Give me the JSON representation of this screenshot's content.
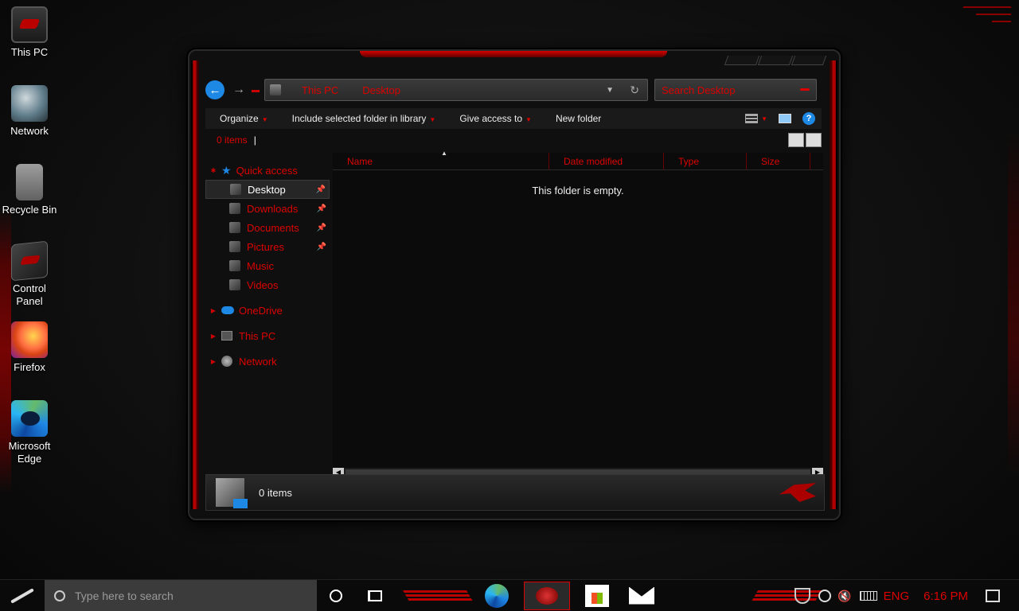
{
  "desktop": {
    "icons": [
      {
        "label": "This PC",
        "icon": "this-pc-icon"
      },
      {
        "label": "Network",
        "icon": "network-globe-icon"
      },
      {
        "label": "Recycle Bin",
        "icon": "recycle-bin-icon"
      },
      {
        "label": "Control Panel",
        "icon": "control-panel-icon"
      },
      {
        "label": "Firefox",
        "icon": "firefox-icon"
      },
      {
        "label": "Microsoft Edge",
        "icon": "edge-icon"
      }
    ]
  },
  "explorer": {
    "address": {
      "crumbs": [
        "This PC",
        "Desktop"
      ]
    },
    "search_placeholder": "Search Desktop",
    "toolbar": {
      "organize": "Organize",
      "include": "Include selected folder in library",
      "give_access": "Give access to",
      "new_folder": "New folder"
    },
    "status_top": "0 items",
    "nav": {
      "quick_access": "Quick access",
      "quick_items": [
        {
          "label": "Desktop",
          "pinned": true,
          "selected": true
        },
        {
          "label": "Downloads",
          "pinned": true
        },
        {
          "label": "Documents",
          "pinned": true
        },
        {
          "label": "Pictures",
          "pinned": true
        },
        {
          "label": "Music",
          "pinned": false
        },
        {
          "label": "Videos",
          "pinned": false
        }
      ],
      "onedrive": "OneDrive",
      "this_pc": "This PC",
      "network": "Network"
    },
    "columns": [
      "Name",
      "Date modified",
      "Type",
      "Size"
    ],
    "empty_message": "This folder is empty.",
    "details_text": "0 items"
  },
  "taskbar": {
    "search_placeholder": "Type here to search",
    "language": "ENG",
    "time": "6:16 PM"
  },
  "colors": {
    "accent": "#dd0000",
    "link_blue": "#1e88e5"
  }
}
